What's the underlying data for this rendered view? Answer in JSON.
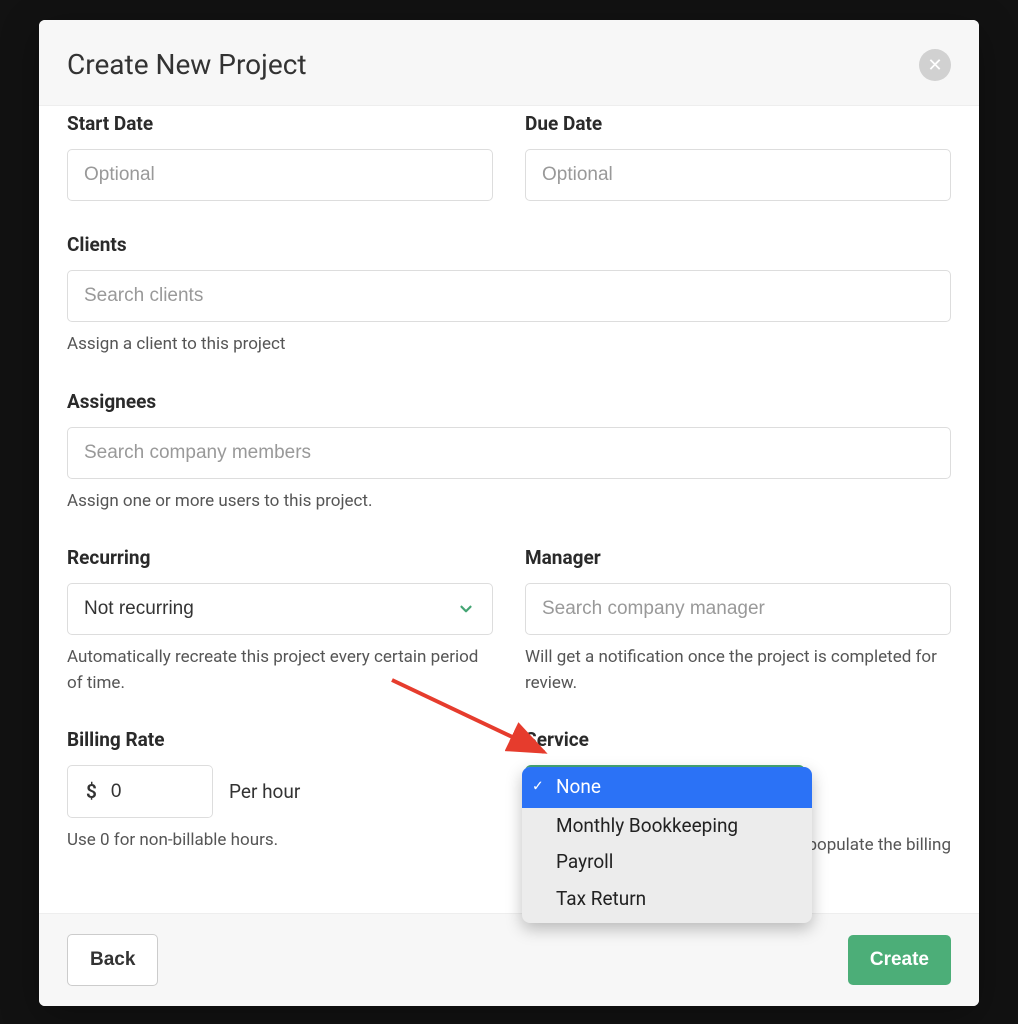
{
  "modal": {
    "title": "Create New Project"
  },
  "fields": {
    "start_date": {
      "label": "Start Date",
      "placeholder": "Optional"
    },
    "due_date": {
      "label": "Due Date",
      "placeholder": "Optional"
    },
    "clients": {
      "label": "Clients",
      "placeholder": "Search clients",
      "help": "Assign a client to this project"
    },
    "assignees": {
      "label": "Assignees",
      "placeholder": "Search company members",
      "help": "Assign one or more users to this project."
    },
    "recurring": {
      "label": "Recurring",
      "value": "Not recurring",
      "help": "Automatically recreate this project every certain period of time."
    },
    "manager": {
      "label": "Manager",
      "placeholder": "Search company manager",
      "help": "Will get a notification once the project is completed for review."
    },
    "billing_rate": {
      "label": "Billing Rate",
      "currency": "$",
      "value": "0",
      "unit": "Per hour",
      "help": "Use 0 for non-billable hours."
    },
    "service": {
      "label": "Service",
      "help_suffix": "populate the billing",
      "options": [
        "None",
        "Monthly Bookkeeping",
        "Payroll",
        "Tax Return"
      ],
      "selected": "None"
    }
  },
  "footer": {
    "back": "Back",
    "create": "Create"
  }
}
